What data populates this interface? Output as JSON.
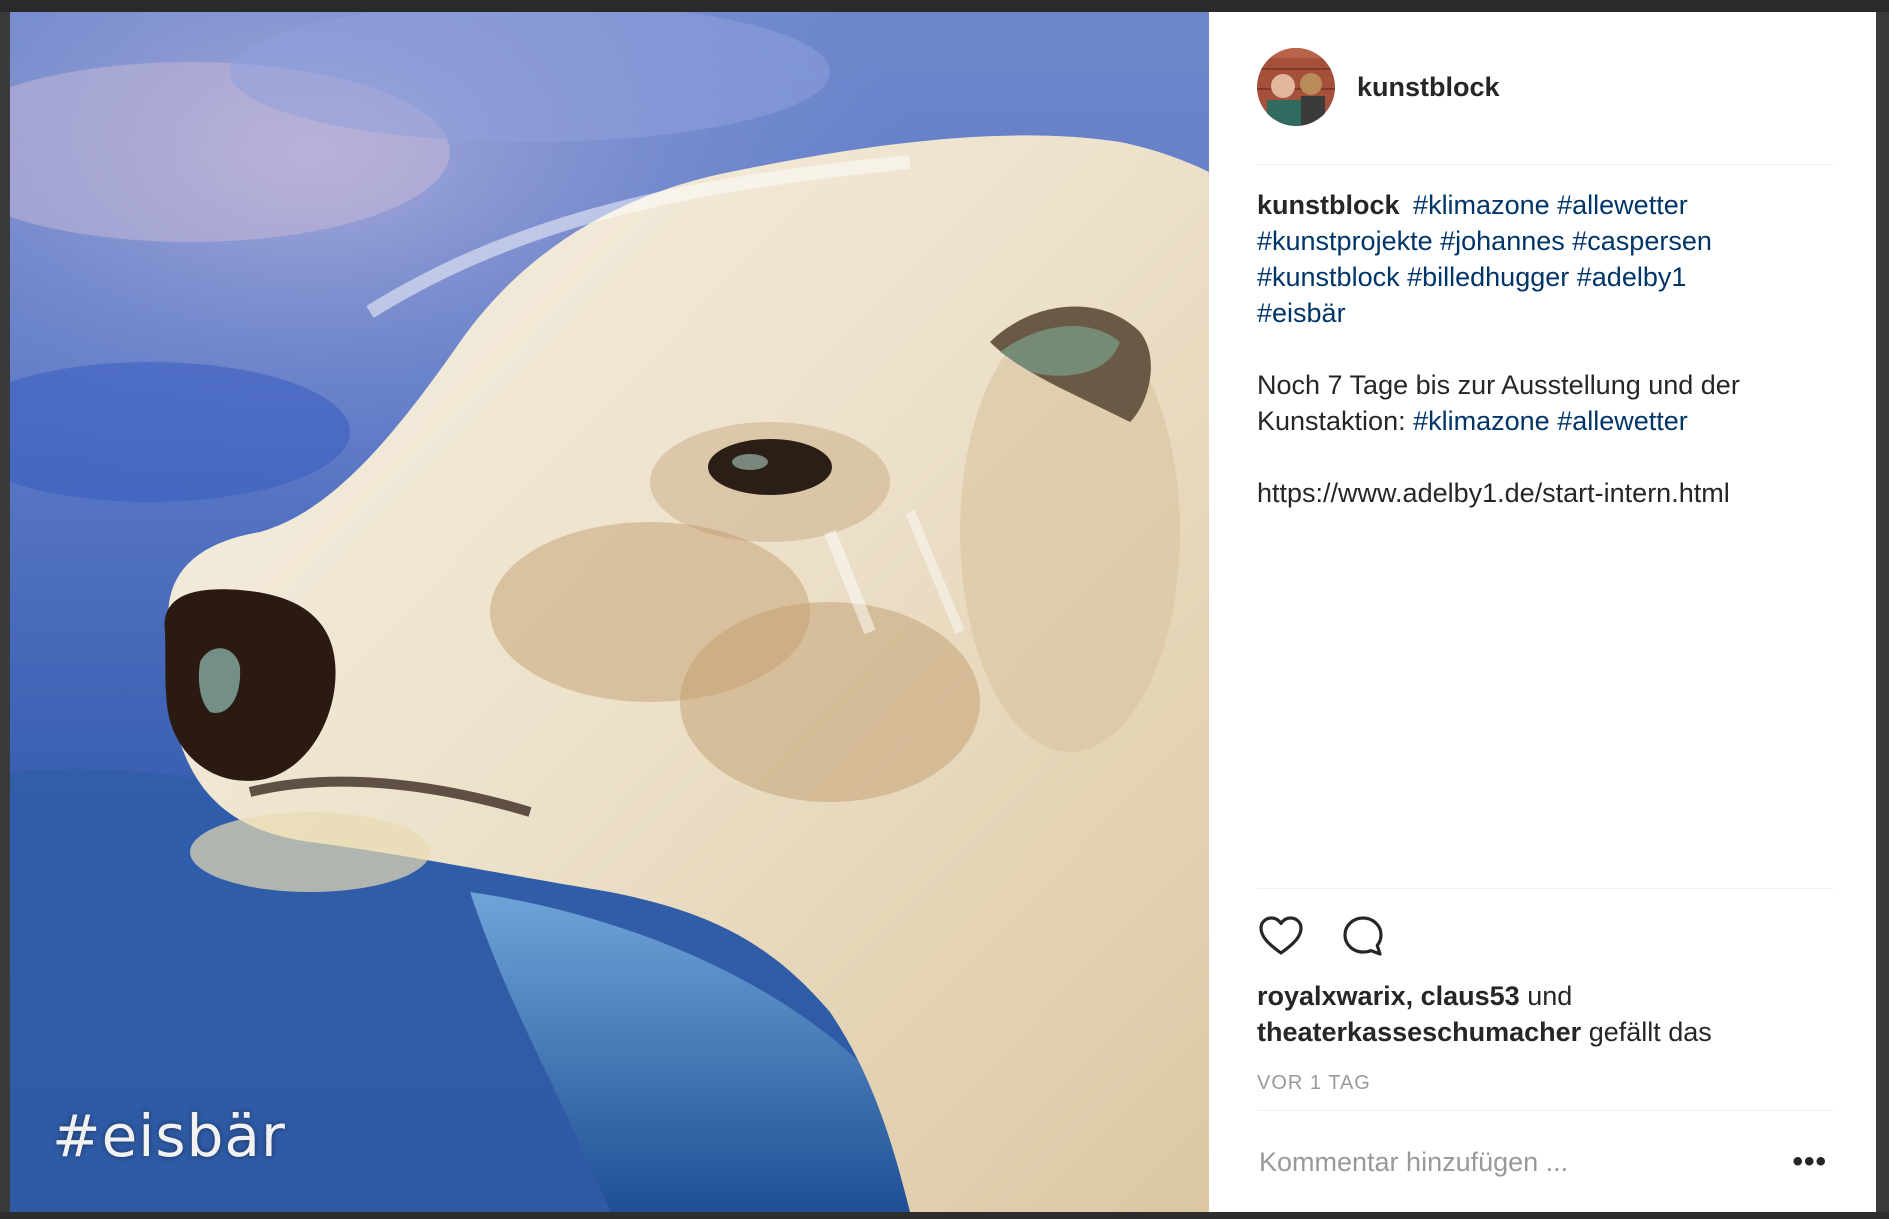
{
  "post": {
    "username": "kunstblock",
    "photo_overlay_text": "#eisbär",
    "caption": {
      "author": "kunstblock",
      "line1_tags": [
        "#klimazone",
        "#allewetter"
      ],
      "line2_tags": [
        "#kunstprojekte",
        "#johannes",
        "#caspersen"
      ],
      "line3_tags": [
        "#kunstblock",
        "#billedhugger",
        "#adelby1"
      ],
      "line4_tags": [
        "#eisbär"
      ],
      "paragraph_text": "Noch 7 Tage bis zur Ausstellung und der Kunstaktion:",
      "paragraph_tags": [
        "#klimazone",
        "#allewetter"
      ],
      "url": "https://www.adelby1.de/start-intern.html"
    },
    "likes": {
      "user1": "royalxwarix",
      "sep": ",",
      "user2": "claus53",
      "and": "und",
      "user3": "theaterkasseschumacher",
      "suffix": "gefällt das"
    },
    "timestamp": "VOR 1 TAG",
    "comment_placeholder": "Kommentar hinzufügen ...",
    "more_label": "•••"
  },
  "icons": {
    "like": "heart-icon",
    "comment": "comment-bubble-icon",
    "more": "more-options-icon"
  },
  "colors": {
    "hashtag": "#003569",
    "text": "#262626",
    "muted": "#999999",
    "divider": "#efefef"
  }
}
